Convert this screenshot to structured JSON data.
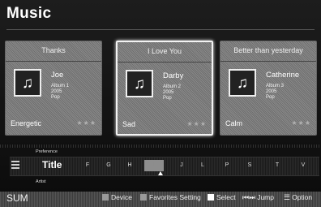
{
  "header": {
    "title": "Music"
  },
  "cards": [
    {
      "title": "Thanks",
      "artist": "Joe",
      "album": "Album 1",
      "year": "2005",
      "genre": "Pop",
      "mood": "Energetic",
      "stars": "★★★"
    },
    {
      "title": "I Love You",
      "artist": "Darby",
      "album": "Album 2",
      "year": "2005",
      "genre": "Pop",
      "mood": "Sad",
      "stars": "★★★"
    },
    {
      "title": "Better than yesterday",
      "artist": "Catherine",
      "album": "Album 3",
      "year": "2005",
      "genre": "Pop",
      "mood": "Calm",
      "stars": "★★★"
    }
  ],
  "sort": {
    "above_label": "Preference",
    "current": "Title",
    "below_label": "Artist",
    "letters": [
      "F",
      "G",
      "H",
      "I",
      "J",
      "L",
      "P",
      "S",
      "T",
      "V"
    ],
    "selected_letter": "I"
  },
  "footer": {
    "sum": "SUM",
    "device": "Device",
    "favorites": "Favorites Setting",
    "select": "Select",
    "jump": "Jump",
    "option": "Option"
  },
  "colors": {
    "selected_border": "#f3f3f3",
    "highlight": "#8d8d8d"
  }
}
